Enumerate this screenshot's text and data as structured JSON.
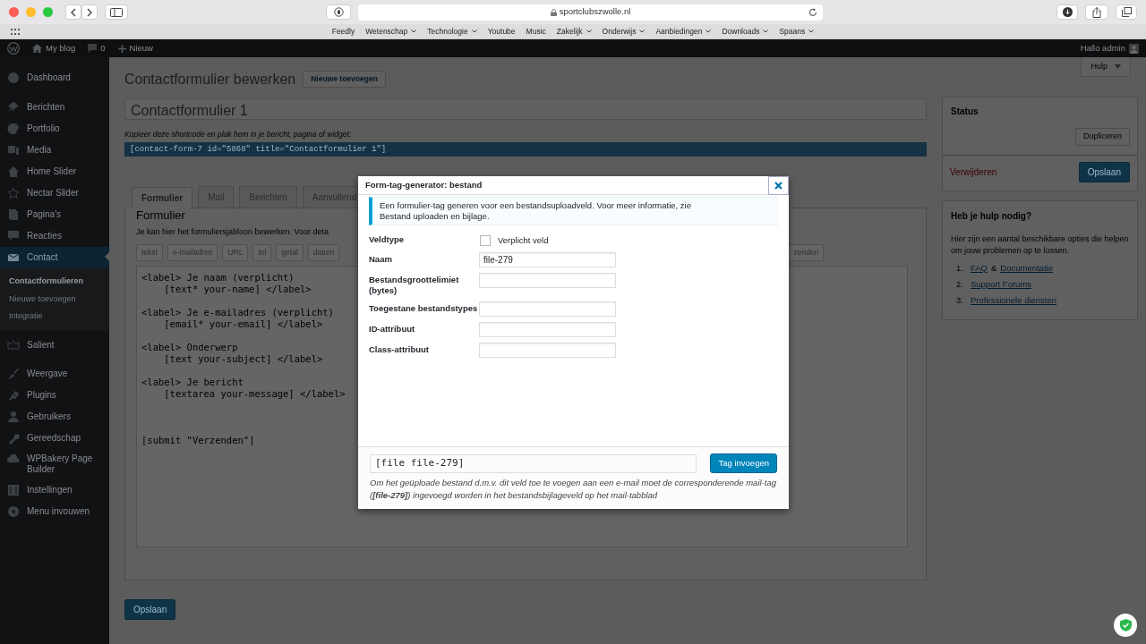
{
  "browser": {
    "url": "sportclubszwolle.nl",
    "bookmarks": [
      {
        "label": "Feedly",
        "menu": false
      },
      {
        "label": "Wetenschap",
        "menu": true
      },
      {
        "label": "Technologie",
        "menu": true
      },
      {
        "label": "Youtube",
        "menu": false
      },
      {
        "label": "Music",
        "menu": false
      },
      {
        "label": "Zakelijk",
        "menu": true
      },
      {
        "label": "Onderwijs",
        "menu": true
      },
      {
        "label": "Aanbiedingen",
        "menu": true
      },
      {
        "label": "Downloads",
        "menu": true
      },
      {
        "label": "Spaans",
        "menu": true
      }
    ]
  },
  "admin_bar": {
    "site": "My blog",
    "comments": "0",
    "new": "Nieuw",
    "greeting": "Hallo admin"
  },
  "help_tab": "Hulp",
  "sidebar": {
    "items": [
      {
        "label": "Dashboard",
        "selected": false
      },
      {
        "label": "Berichten",
        "selected": false
      },
      {
        "label": "Portfolio",
        "selected": false
      },
      {
        "label": "Media",
        "selected": false
      },
      {
        "label": "Home Slider",
        "selected": false
      },
      {
        "label": "Nectar Slider",
        "selected": false
      },
      {
        "label": "Pagina's",
        "selected": false
      },
      {
        "label": "Reacties",
        "selected": false
      },
      {
        "label": "Contact",
        "selected": true,
        "children": [
          {
            "label": "Contactformulieren",
            "selected": true
          },
          {
            "label": "Nieuwe toevoegen",
            "selected": false
          },
          {
            "label": "Integratie",
            "selected": false
          }
        ]
      },
      {
        "label": "Salient",
        "selected": false
      },
      {
        "label": "Weergave",
        "selected": false
      },
      {
        "label": "Plugins",
        "selected": false
      },
      {
        "label": "Gebruikers",
        "selected": false
      },
      {
        "label": "Gereedschap",
        "selected": false
      },
      {
        "label": "WPBakery Page Builder",
        "selected": false
      },
      {
        "label": "Instellingen",
        "selected": false
      },
      {
        "label": "Menu invouwen",
        "selected": false
      }
    ]
  },
  "page": {
    "title": "Contactformulier bewerken",
    "add_new": "Nieuwe toevoegen",
    "form_title": "Contactformulier 1",
    "shortcode_hint": "Kopieer deze shortcode en plak hem in je bericht, pagina of widget:",
    "shortcode": "[contact-form-7 id=\"5868\" title=\"Contactformulier 1\"]",
    "tabs": [
      {
        "label": "Formulier",
        "selected": true
      },
      {
        "label": "Mail",
        "selected": false
      },
      {
        "label": "Berichten",
        "selected": false
      },
      {
        "label": "Aanvullend",
        "selected": false
      }
    ],
    "panel_title": "Formulier",
    "panel_text": "Je kan hier het formuliersjabloon bewerken. Voor deta",
    "tag_buttons": [
      "tekst",
      "e-mailadres",
      "URL",
      "tel",
      "getal",
      "datum"
    ],
    "tag_buttons_right": [
      "zenden"
    ],
    "code_blocks": [
      [
        "<label> Je naam (verplicht)",
        "    [text* your-name] </label>"
      ],
      [
        "<label> Je e-mailadres (verplicht)",
        "    [email* your-email] </label>"
      ],
      [
        "<label> Onderwerp",
        "    [text your-subject] </label>"
      ],
      [
        "<label> Je bericht",
        "    [textarea your-message] </label>"
      ],
      [
        "[submit \"Verzenden\"]"
      ]
    ],
    "save": "Opslaan"
  },
  "status_box": {
    "title": "Status",
    "duplicate": "Dupliceren",
    "delete": "Verwijderen",
    "save": "Opslaan"
  },
  "help_box": {
    "title": "Heb je hulp nodig?",
    "text": "Hier zijn een aantal beschikbare opties die helpen om jouw problemen op te lossen.",
    "items": [
      {
        "number": "1.",
        "parts": [
          {
            "text": "FAQ",
            "link": true
          },
          {
            "text": "&",
            "link": false
          },
          {
            "text": "Documentatie",
            "link": true
          }
        ]
      },
      {
        "number": "2.",
        "parts": [
          {
            "text": "Support Forums",
            "link": true
          }
        ]
      },
      {
        "number": "3.",
        "parts": [
          {
            "text": "Professionele diensten",
            "link": true
          }
        ]
      }
    ]
  },
  "modal": {
    "title": "Form-tag-generator: bestand",
    "notice": "Een formulier-tag generen voor een bestandsuploadveld. Voor meer informatie, zie",
    "notice_link": "Bestand uploaden en bijlage",
    "notice_end": ".",
    "fields": [
      {
        "label": "Veldtype",
        "kind": "checkbox",
        "option": "Verplicht veld",
        "checked": false
      },
      {
        "label": "Naam",
        "kind": "text",
        "value": "file-279"
      },
      {
        "label": "Bestandsgroottelimiet (bytes)",
        "kind": "text"
      },
      {
        "label": "Toegestane bestandstypes",
        "kind": "text"
      },
      {
        "label": "ID-attribuut",
        "kind": "text"
      },
      {
        "label": "Class-attribuut",
        "kind": "text"
      }
    ],
    "tag_output": "[file file-279]",
    "insert": "Tag invoegen",
    "note": "Om het geüploade bestand d.m.v. dit veld toe te voegen aan een e-mail moet de corresponderende mail-tag (**[file-279]**) ingevoegd worden in het bestandsbijlageveld op het mail-tabblad"
  }
}
